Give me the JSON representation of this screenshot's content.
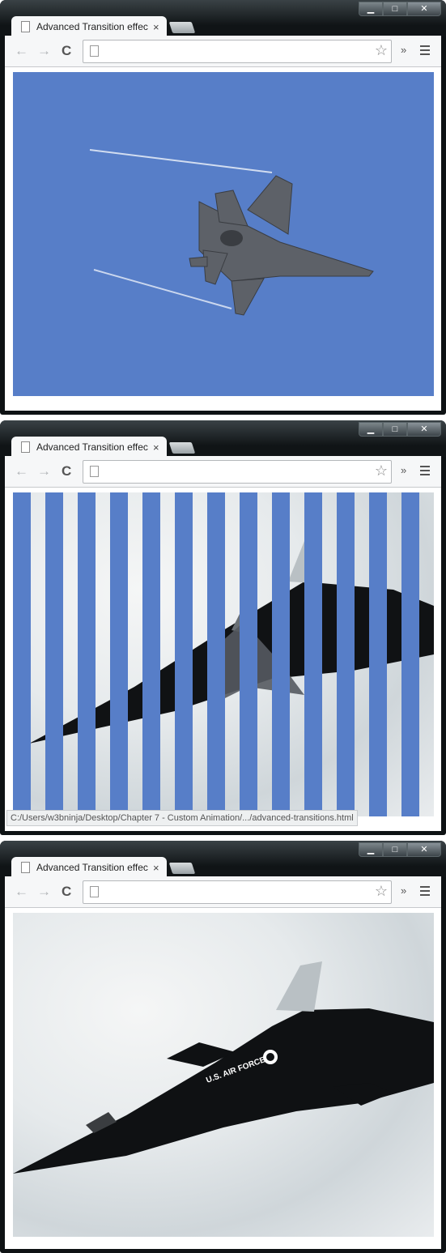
{
  "browser": {
    "tab_title": "Advanced Transition effects",
    "tab_close": "×",
    "back_glyph": "←",
    "forward_glyph": "→",
    "reload_glyph": "C",
    "star_glyph": "☆",
    "extensions_glyph": "»",
    "window_minimize": "▁",
    "window_maximize": "□",
    "window_close": "✕"
  },
  "colors": {
    "sky_blue": "#577ec8",
    "stripe_blue": "#577ec8",
    "window_frame": "#0e1214"
  },
  "images": {
    "first": "fighter-jet-on-blue-sky",
    "second": "blackbird-jet-behind-blue-stripes",
    "third": "blackbird-jet-over-clouds"
  },
  "aircraft_marking": "U.S. AIR FORCE",
  "status_bar": "C:/Users/w3bninja/Desktop/Chapter 7 - Custom Animation/.../advanced-transitions.html"
}
